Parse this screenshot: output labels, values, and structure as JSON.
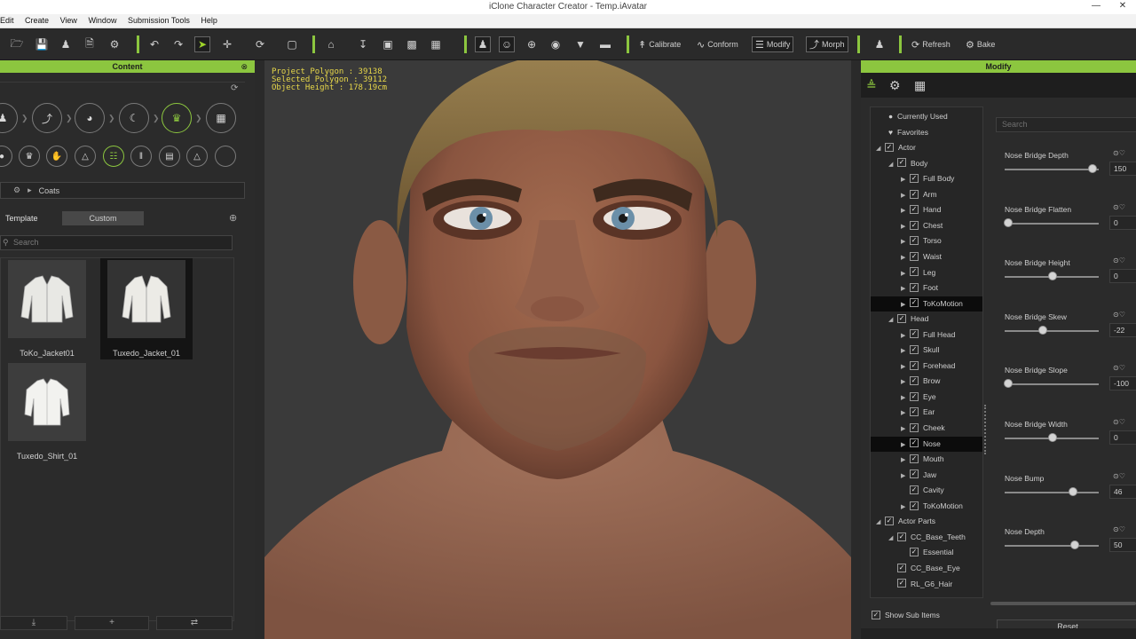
{
  "window": {
    "title": "iClone Character Creator - Temp.iAvatar",
    "minimize": "—",
    "close": "✕"
  },
  "menu": [
    "Edit",
    "Create",
    "View",
    "Window",
    "Submission Tools",
    "Help"
  ],
  "toolbar": {
    "calibrate": "Calibrate",
    "conform": "Conform",
    "modify": "Modify",
    "morph": "Morph",
    "refresh": "Refresh",
    "bake": "Bake"
  },
  "content": {
    "title": "Content",
    "breadcrumb": "Coats",
    "tabs": {
      "template": "Template",
      "custom": "Custom"
    },
    "search_placeholder": "Search",
    "items": [
      {
        "label": "ToKo_Jacket01"
      },
      {
        "label": "Tuxedo_Jacket_01"
      },
      {
        "label": "Tuxedo_Shirt_01"
      }
    ]
  },
  "viewport": {
    "project_polygon": "Project Polygon : 39138",
    "selected_polygon": "Selected Polygon : 39112",
    "object_height": "Object Height : 178.19cm"
  },
  "modify": {
    "title": "Modify",
    "search_placeholder": "Search",
    "tree": [
      {
        "label": "Currently Used"
      },
      {
        "label": "Favorites"
      },
      {
        "label": "Actor"
      },
      {
        "label": "Body"
      },
      {
        "label": "Full Body"
      },
      {
        "label": "Arm"
      },
      {
        "label": "Hand"
      },
      {
        "label": "Chest"
      },
      {
        "label": "Torso"
      },
      {
        "label": "Waist"
      },
      {
        "label": "Leg"
      },
      {
        "label": "Foot"
      },
      {
        "label": "ToKoMotion"
      },
      {
        "label": "Head"
      },
      {
        "label": "Full Head"
      },
      {
        "label": "Skull"
      },
      {
        "label": "Forehead"
      },
      {
        "label": "Brow"
      },
      {
        "label": "Eye"
      },
      {
        "label": "Ear"
      },
      {
        "label": "Cheek"
      },
      {
        "label": "Nose"
      },
      {
        "label": "Mouth"
      },
      {
        "label": "Jaw"
      },
      {
        "label": "Cavity"
      },
      {
        "label": "ToKoMotion"
      },
      {
        "label": "Actor Parts"
      },
      {
        "label": "CC_Base_Teeth"
      },
      {
        "label": "Essential"
      },
      {
        "label": "CC_Base_Eye"
      },
      {
        "label": "RL_G6_Hair"
      }
    ],
    "show_sub_items": "Show Sub Items",
    "params": [
      {
        "label": "Nose Bridge Depth",
        "value": "150",
        "level": 0.95
      },
      {
        "label": "Nose Bridge Flatten",
        "value": "0",
        "level": 0.0
      },
      {
        "label": "Nose Bridge Height",
        "value": "0",
        "level": 0.5
      },
      {
        "label": "Nose Bridge Skew",
        "value": "-22",
        "level": 0.39
      },
      {
        "label": "Nose Bridge Slope",
        "value": "-100",
        "level": 0.0
      },
      {
        "label": "Nose Bridge Width",
        "value": "0",
        "level": 0.5
      },
      {
        "label": "Nose Bump",
        "value": "46",
        "level": 0.73
      },
      {
        "label": "Nose Depth",
        "value": "50",
        "level": 0.75
      }
    ],
    "reset": "Reset"
  },
  "colors": {
    "accent": "#8cc63f",
    "stats": "#e8d84a"
  }
}
